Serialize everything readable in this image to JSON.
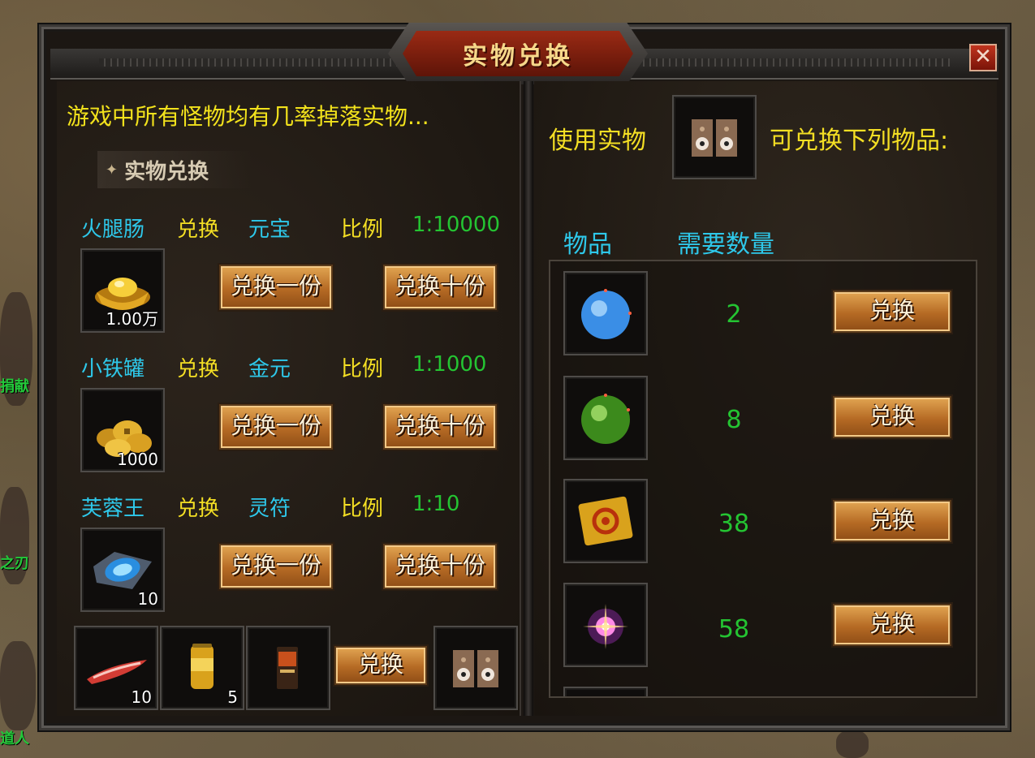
{
  "window": {
    "title": "实物兑换",
    "close_label": "✕"
  },
  "left": {
    "intro": "游戏中所有怪物均有几率掉落实物...",
    "section_label": "实物兑换",
    "rows": [
      {
        "source": "火腿肠",
        "action": "兑换",
        "target": "元宝",
        "ratio_label": "比例",
        "ratio": "1:10000",
        "slot_qty": "1.00万",
        "icon": "gold-ingot-icon",
        "btn_one": "兑换一份",
        "btn_ten": "兑换十份"
      },
      {
        "source": "小铁罐",
        "action": "兑换",
        "target": "金元",
        "ratio_label": "比例",
        "ratio": "1:1000",
        "slot_qty": "1000",
        "icon": "gold-coins-icon",
        "btn_one": "兑换一份",
        "btn_ten": "兑换十份"
      },
      {
        "source": "芙蓉王",
        "action": "兑换",
        "target": "灵符",
        "ratio_label": "比例",
        "ratio": "1:10",
        "slot_qty": "10",
        "icon": "blue-talisman-icon",
        "btn_one": "兑换一份",
        "btn_ten": "兑换十份"
      }
    ],
    "bottom": {
      "items": [
        {
          "icon": "red-sausage-icon",
          "qty": "10"
        },
        {
          "icon": "gold-can-icon",
          "qty": "5"
        },
        {
          "icon": "cigarette-pack-icon",
          "qty": ""
        }
      ],
      "exchange_label": "兑换",
      "result_icon": "speaker-icon"
    }
  },
  "right": {
    "use_label": "使用实物",
    "use_icon": "speaker-icon",
    "can_label": "可兑换下列物品:",
    "header_item": "物品",
    "header_qty": "需要数量",
    "items": [
      {
        "icon": "blue-orb-icon",
        "required": "2",
        "button": "兑换"
      },
      {
        "icon": "green-orb-icon",
        "required": "8",
        "button": "兑换"
      },
      {
        "icon": "golden-scroll-icon",
        "required": "38",
        "button": "兑换"
      },
      {
        "icon": "rainbow-star-icon",
        "required": "58",
        "button": "兑换"
      }
    ]
  },
  "background": {
    "labels": [
      "捐献",
      "之刃",
      "道人"
    ]
  },
  "colors": {
    "cyan": "#2ec8ea",
    "yellow": "#f4df24",
    "green": "#24c432",
    "button": "#b56a24",
    "title_red": "#9a2a14"
  }
}
